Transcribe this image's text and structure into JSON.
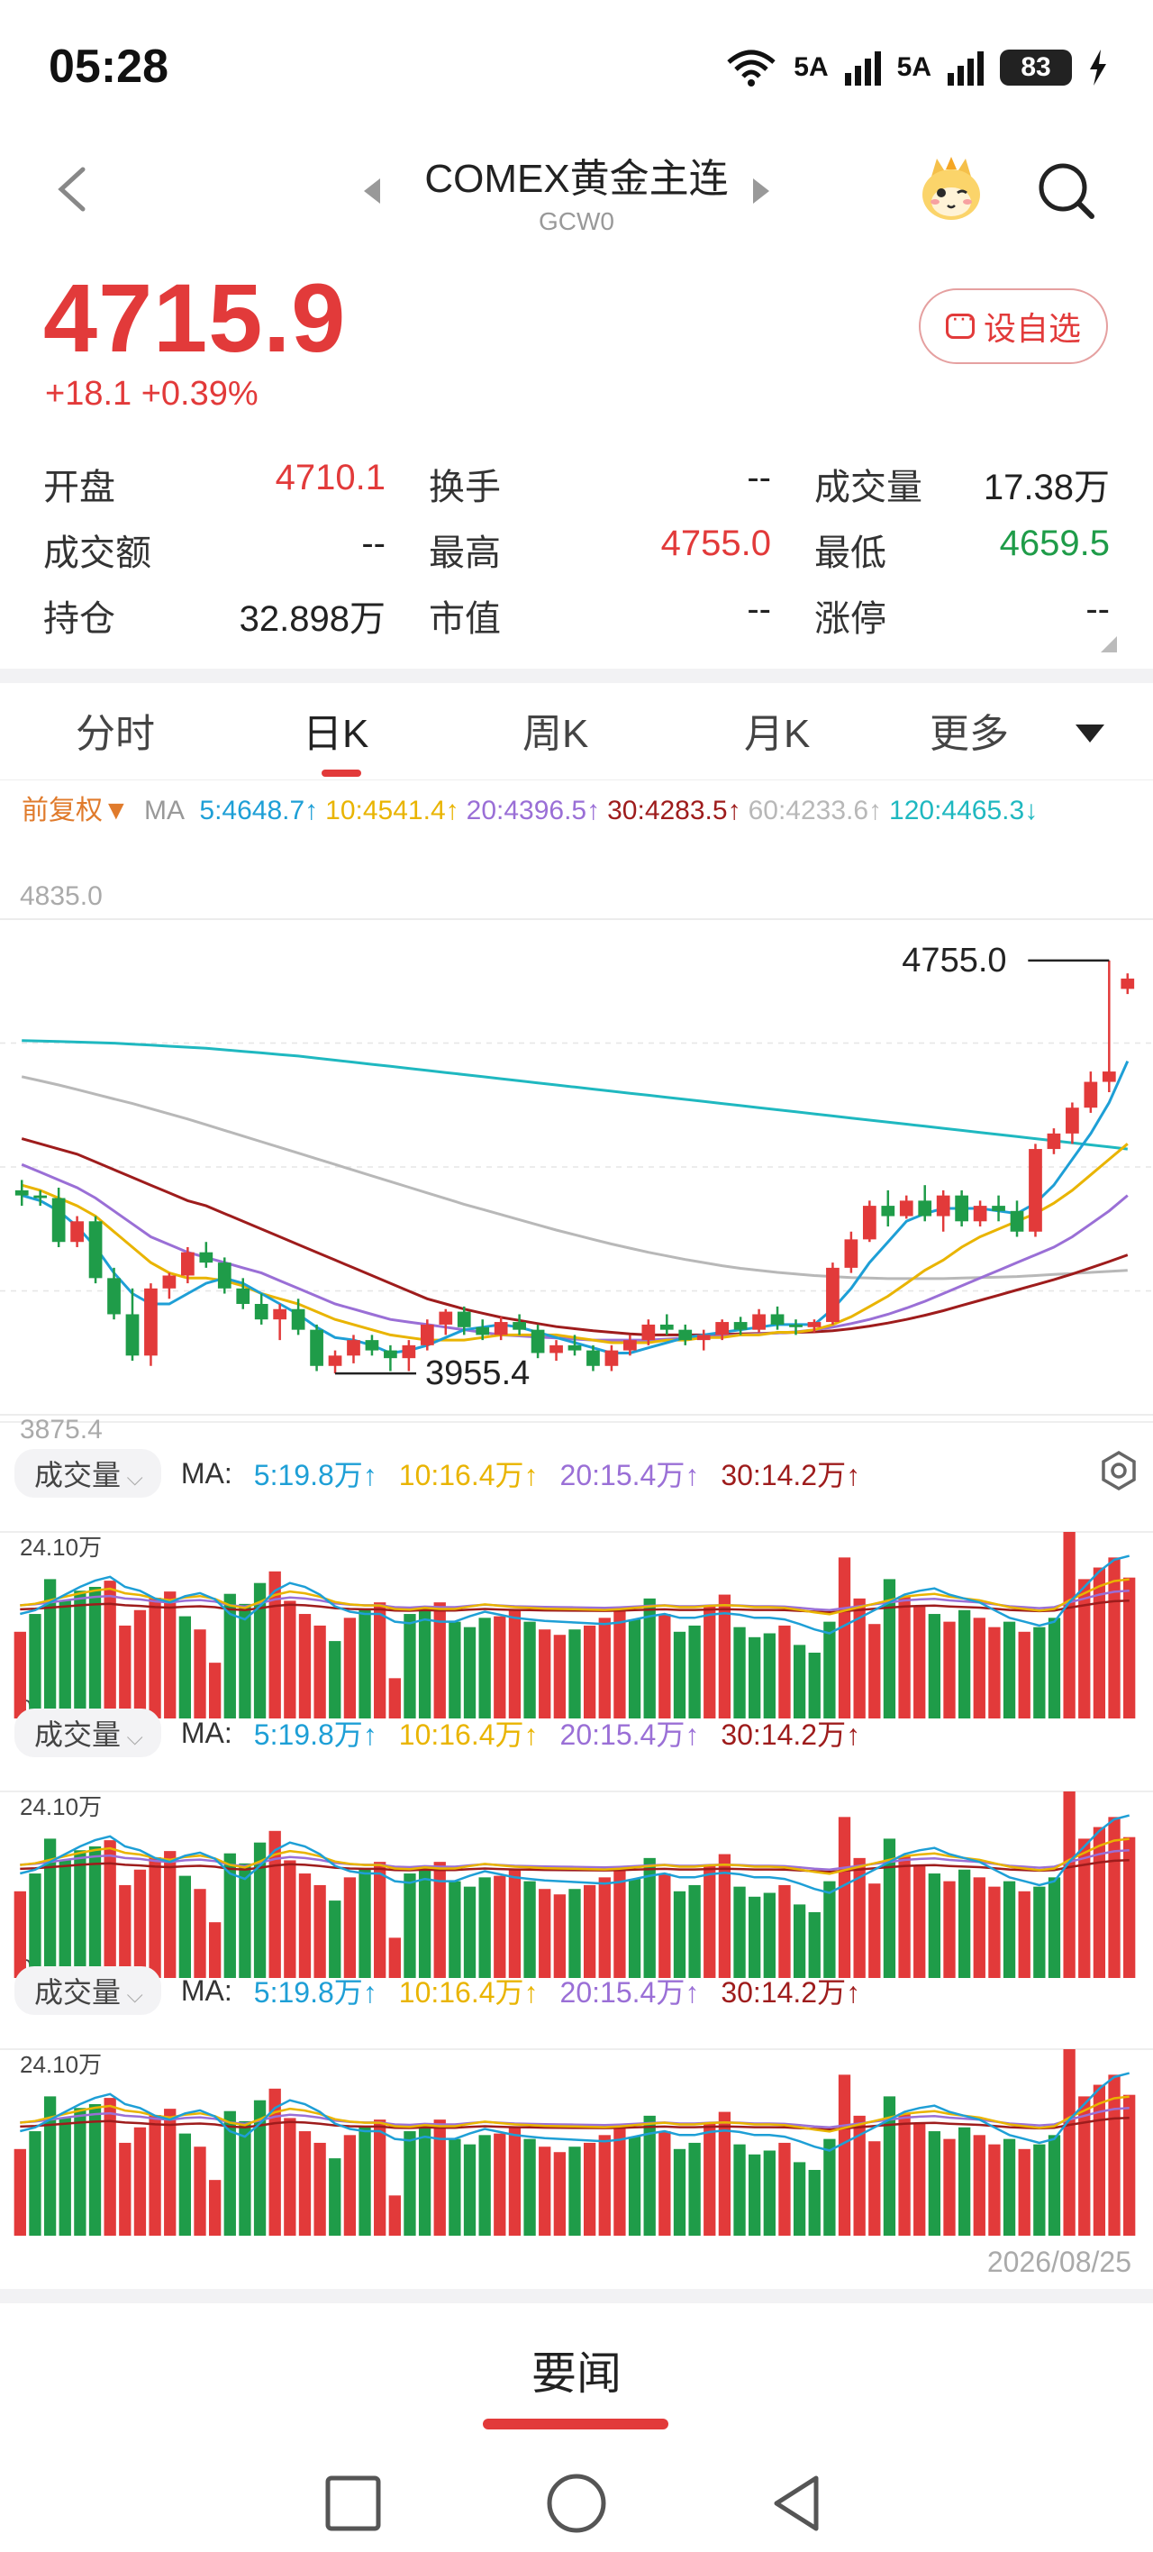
{
  "status_bar": {
    "time": "05:28",
    "network1": "5A",
    "network2": "5A",
    "battery": "83"
  },
  "header": {
    "title": "COMEX黄金主连",
    "code": "GCW0"
  },
  "quote": {
    "price": "4715.9",
    "change": "+18.1  +0.39%",
    "favorite_label": "设自选"
  },
  "stats": [
    [
      {
        "label": "开盘",
        "value": "4710.1",
        "tone": "red"
      },
      {
        "label": "换手",
        "value": "--",
        "tone": ""
      },
      {
        "label": "成交量",
        "value": "17.38万",
        "tone": ""
      }
    ],
    [
      {
        "label": "成交额",
        "value": "--",
        "tone": ""
      },
      {
        "label": "最高",
        "value": "4755.0",
        "tone": "red"
      },
      {
        "label": "最低",
        "value": "4659.5",
        "tone": "green"
      }
    ],
    [
      {
        "label": "持仓",
        "value": "32.898万",
        "tone": ""
      },
      {
        "label": "市值",
        "value": "--",
        "tone": ""
      },
      {
        "label": "涨停",
        "value": "--",
        "tone": ""
      }
    ]
  ],
  "tabs": [
    "分时",
    "日K",
    "周K",
    "月K",
    "更多"
  ],
  "active_tab": 1,
  "ma_legend": {
    "adjust": "前复权▼",
    "label": "MA",
    "items": [
      {
        "text": "5:4648.7↑",
        "color": "#1e9fd6"
      },
      {
        "text": "10:4541.4↑",
        "color": "#e9b400"
      },
      {
        "text": "20:4396.5↑",
        "color": "#9a6fd6"
      },
      {
        "text": "30:4283.5↑",
        "color": "#9e1c1c"
      },
      {
        "text": "60:4233.6↑",
        "color": "#b8b8b8"
      },
      {
        "text": "120:4465.3↓",
        "color": "#1fb8c0"
      }
    ]
  },
  "colors": {
    "up": "#e23a3a",
    "down": "#1f9c49"
  },
  "volume_panels": [
    {
      "pill": "成交量",
      "ma": "MA:",
      "items": [
        {
          "text": "5:19.8万↑",
          "color": "#1e9fd6"
        },
        {
          "text": "10:16.4万↑",
          "color": "#e9b400"
        },
        {
          "text": "20:15.4万↑",
          "color": "#9a6fd6"
        },
        {
          "text": "30:14.2万↑",
          "color": "#9e1c1c"
        }
      ],
      "max_label": "24.10万",
      "zero_label": "0"
    },
    {
      "pill": "成交量",
      "ma": "MA:",
      "items": [
        {
          "text": "5:19.8万↑",
          "color": "#1e9fd6"
        },
        {
          "text": "10:16.4万↑",
          "color": "#e9b400"
        },
        {
          "text": "20:15.4万↑",
          "color": "#9a6fd6"
        },
        {
          "text": "30:14.2万↑",
          "color": "#9e1c1c"
        }
      ],
      "max_label": "24.10万",
      "zero_label": "0"
    },
    {
      "pill": "成交量",
      "ma": "MA:",
      "items": [
        {
          "text": "5:19.8万↑",
          "color": "#1e9fd6"
        },
        {
          "text": "10:16.4万↑",
          "color": "#e9b400"
        },
        {
          "text": "20:15.4万↑",
          "color": "#9a6fd6"
        },
        {
          "text": "30:14.2万↑",
          "color": "#9e1c1c"
        }
      ],
      "max_label": "24.10万",
      "zero_label": ""
    }
  ],
  "date_label": "2026/08/25",
  "bottom_tab": "要闻",
  "chart_data": {
    "type": "candlestick",
    "y_max_label": "4835.0",
    "y_min_label": "3875.4",
    "ylim": [
      3875.4,
      4835.0
    ],
    "high_annotation": "4755.0",
    "low_annotation": "3955.4",
    "high_value": 4755.0,
    "low_value": 3955.4,
    "candles": [
      [
        4310,
        4330,
        4280,
        4300
      ],
      [
        4300,
        4310,
        4280,
        4295
      ],
      [
        4295,
        4315,
        4200,
        4210
      ],
      [
        4210,
        4260,
        4200,
        4250
      ],
      [
        4250,
        4260,
        4130,
        4140
      ],
      [
        4140,
        4160,
        4060,
        4070
      ],
      [
        4070,
        4120,
        3980,
        3990
      ],
      [
        3990,
        4130,
        3970,
        4120
      ],
      [
        4120,
        4150,
        4100,
        4145
      ],
      [
        4145,
        4200,
        4130,
        4190
      ],
      [
        4190,
        4210,
        4160,
        4170
      ],
      [
        4170,
        4180,
        4110,
        4120
      ],
      [
        4120,
        4140,
        4080,
        4090
      ],
      [
        4090,
        4110,
        4050,
        4060
      ],
      [
        4060,
        4090,
        4020,
        4080
      ],
      [
        4080,
        4100,
        4030,
        4040
      ],
      [
        4040,
        4050,
        3960,
        3970
      ],
      [
        3970,
        4000,
        3955.4,
        3990
      ],
      [
        3990,
        4030,
        3975,
        4020
      ],
      [
        4020,
        4030,
        3990,
        4000
      ],
      [
        4000,
        4010,
        3960,
        3985
      ],
      [
        3985,
        4020,
        3960,
        4010
      ],
      [
        4010,
        4060,
        4000,
        4050
      ],
      [
        4050,
        4080,
        4030,
        4075
      ],
      [
        4075,
        4085,
        4030,
        4045
      ],
      [
        4045,
        4060,
        4020,
        4030
      ],
      [
        4030,
        4065,
        4020,
        4055
      ],
      [
        4055,
        4070,
        4030,
        4040
      ],
      [
        4040,
        4050,
        3985,
        3995
      ],
      [
        3995,
        4020,
        3980,
        4010
      ],
      [
        4010,
        4030,
        3990,
        4000
      ],
      [
        4000,
        4010,
        3960,
        3970
      ],
      [
        3970,
        4010,
        3960,
        4000
      ],
      [
        4000,
        4030,
        3990,
        4020
      ],
      [
        4020,
        4060,
        4010,
        4050
      ],
      [
        4050,
        4070,
        4030,
        4040
      ],
      [
        4040,
        4050,
        4010,
        4020
      ],
      [
        4020,
        4040,
        4000,
        4030
      ],
      [
        4030,
        4060,
        4020,
        4055
      ],
      [
        4055,
        4065,
        4030,
        4040
      ],
      [
        4040,
        4080,
        4035,
        4070
      ],
      [
        4070,
        4085,
        4040,
        4050
      ],
      [
        4050,
        4060,
        4030,
        4045
      ],
      [
        4045,
        4060,
        4035,
        4055
      ],
      [
        4055,
        4170,
        4050,
        4160
      ],
      [
        4160,
        4230,
        4150,
        4215
      ],
      [
        4215,
        4290,
        4210,
        4280
      ],
      [
        4280,
        4310,
        4240,
        4260
      ],
      [
        4260,
        4300,
        4255,
        4290
      ],
      [
        4290,
        4320,
        4250,
        4260
      ],
      [
        4260,
        4310,
        4230,
        4300
      ],
      [
        4300,
        4310,
        4240,
        4250
      ],
      [
        4250,
        4290,
        4240,
        4280
      ],
      [
        4280,
        4300,
        4250,
        4270
      ],
      [
        4270,
        4290,
        4220,
        4230
      ],
      [
        4230,
        4400,
        4220,
        4390
      ],
      [
        4390,
        4430,
        4380,
        4420
      ],
      [
        4420,
        4480,
        4400,
        4470
      ],
      [
        4470,
        4540,
        4460,
        4520
      ],
      [
        4520,
        4755,
        4500,
        4540
      ],
      [
        4700,
        4730,
        4690,
        4720
      ]
    ],
    "ma5": [
      4300,
      4290,
      4270,
      4240,
      4200,
      4150,
      4110,
      4090,
      4090,
      4110,
      4130,
      4140,
      4130,
      4110,
      4090,
      4070,
      4045,
      4025,
      4020,
      4010,
      3995,
      4000,
      4010,
      4025,
      4040,
      4045,
      4050,
      4045,
      4035,
      4025,
      4015,
      4005,
      3995,
      3995,
      4005,
      4015,
      4025,
      4030,
      4035,
      4040,
      4045,
      4050,
      4050,
      4050,
      4080,
      4120,
      4170,
      4210,
      4250,
      4265,
      4275,
      4275,
      4275,
      4270,
      4265,
      4285,
      4320,
      4370,
      4420,
      4480,
      4560
    ],
    "ma10": [
      4320,
      4310,
      4295,
      4280,
      4260,
      4230,
      4200,
      4170,
      4150,
      4140,
      4140,
      4135,
      4125,
      4110,
      4100,
      4090,
      4075,
      4060,
      4050,
      4040,
      4030,
      4025,
      4020,
      4020,
      4020,
      4025,
      4030,
      4030,
      4030,
      4030,
      4025,
      4020,
      4015,
      4015,
      4015,
      4020,
      4020,
      4025,
      4025,
      4030,
      4030,
      4035,
      4035,
      4040,
      4050,
      4065,
      4085,
      4105,
      4130,
      4155,
      4175,
      4200,
      4220,
      4235,
      4250,
      4265,
      4285,
      4310,
      4340,
      4370,
      4400
    ],
    "ma20": [
      4360,
      4345,
      4330,
      4315,
      4295,
      4270,
      4245,
      4220,
      4205,
      4190,
      4180,
      4170,
      4160,
      4150,
      4135,
      4120,
      4105,
      4090,
      4080,
      4070,
      4060,
      4055,
      4050,
      4045,
      4040,
      4035,
      4030,
      4028,
      4026,
      4024,
      4022,
      4020,
      4020,
      4020,
      4020,
      4022,
      4024,
      4026,
      4028,
      4030,
      4032,
      4034,
      4036,
      4040,
      4045,
      4052,
      4060,
      4070,
      4082,
      4095,
      4110,
      4125,
      4140,
      4155,
      4170,
      4185,
      4200,
      4220,
      4245,
      4270,
      4300
    ],
    "ma30": [
      4410,
      4400,
      4390,
      4380,
      4365,
      4350,
      4335,
      4320,
      4305,
      4290,
      4280,
      4265,
      4250,
      4235,
      4220,
      4205,
      4190,
      4175,
      4160,
      4145,
      4130,
      4115,
      4100,
      4090,
      4080,
      4072,
      4064,
      4058,
      4052,
      4046,
      4042,
      4038,
      4035,
      4032,
      4030,
      4030,
      4030,
      4030,
      4031,
      4032,
      4033,
      4034,
      4035,
      4036,
      4038,
      4042,
      4047,
      4053,
      4060,
      4068,
      4077,
      4087,
      4097,
      4107,
      4117,
      4127,
      4137,
      4148,
      4160,
      4172,
      4185
    ],
    "ma60": [
      4530,
      4522,
      4514,
      4505,
      4496,
      4487,
      4478,
      4468,
      4458,
      4448,
      4437,
      4426,
      4415,
      4404,
      4393,
      4382,
      4371,
      4360,
      4349,
      4338,
      4327,
      4316,
      4305,
      4294,
      4283,
      4273,
      4263,
      4253,
      4243,
      4233,
      4224,
      4215,
      4206,
      4198,
      4190,
      4183,
      4176,
      4170,
      4164,
      4159,
      4155,
      4151,
      4148,
      4145,
      4143,
      4141,
      4140,
      4139,
      4139,
      4139,
      4139,
      4140,
      4141,
      4142,
      4143,
      4145,
      4147,
      4149,
      4151,
      4153,
      4155
    ],
    "ma120": [
      4600,
      4599,
      4598,
      4597,
      4596,
      4595,
      4593,
      4591,
      4589,
      4587,
      4585,
      4582,
      4579,
      4576,
      4573,
      4570,
      4566,
      4562,
      4558,
      4554,
      4550,
      4546,
      4542,
      4538,
      4534,
      4530,
      4526,
      4522,
      4518,
      4514,
      4510,
      4506,
      4502,
      4498,
      4494,
      4490,
      4486,
      4482,
      4478,
      4474,
      4470,
      4466,
      4462,
      4458,
      4454,
      4450,
      4446,
      4442,
      4438,
      4434,
      4430,
      4426,
      4422,
      4418,
      4414,
      4410,
      4406,
      4402,
      4398,
      4394,
      4390
    ],
    "volume_max": 24.1,
    "volumes": [
      11.2,
      13.5,
      18.0,
      15.2,
      16.5,
      17.0,
      17.8,
      12.0,
      14.0,
      15.6,
      16.4,
      13.2,
      11.5,
      7.2,
      16.1,
      14.8,
      17.5,
      19.0,
      15.2,
      13.5,
      12.0,
      10.0,
      13.0,
      14.0,
      15.0,
      5.2,
      13.5,
      14.5,
      15.0,
      12.5,
      11.8,
      13.0,
      13.2,
      14.0,
      12.5,
      11.5,
      10.8,
      11.5,
      12.0,
      13.0,
      14.0,
      12.8,
      15.5,
      13.5,
      11.2,
      12.0,
      14.5,
      16.0,
      11.8,
      10.5,
      11.0,
      12.0,
      9.5,
      8.5,
      12.5,
      20.8,
      15.5,
      12.2,
      18.0,
      15.8,
      14.5,
      13.5,
      12.5,
      14.0,
      13.0,
      11.8,
      12.5,
      11.2,
      11.8,
      13.0,
      24.1,
      18.0,
      19.5,
      20.8,
      18.2
    ],
    "volume_up": [
      true,
      false,
      false,
      false,
      false,
      false,
      true,
      true,
      true,
      true,
      true,
      false,
      true,
      true,
      false,
      false,
      false,
      true,
      true,
      true,
      true,
      false,
      true,
      false,
      true,
      true,
      false,
      false,
      true,
      false,
      false,
      false,
      true,
      true,
      false,
      true,
      true,
      false,
      true,
      true,
      true,
      false,
      false,
      true,
      false,
      false,
      true,
      true,
      false,
      false,
      false,
      true,
      false,
      false,
      false,
      true,
      true,
      true,
      false,
      true,
      true,
      false,
      true,
      false,
      true,
      true,
      false,
      true,
      false,
      false,
      true,
      true,
      true,
      true,
      true
    ],
    "vol_ma5": [
      13.5,
      14,
      15,
      16,
      17,
      17.8,
      18.3,
      17,
      16.5,
      15.5,
      15,
      15.8,
      16.2,
      15.4,
      13.5,
      12.8,
      14.5,
      16.5,
      17.5,
      17,
      16,
      14.5,
      13.8,
      13.5,
      13.5,
      12.5,
      12.3,
      12.8,
      12.5,
      12.5,
      13.2,
      13.8,
      13.4,
      13,
      12.8,
      12.6,
      12.5,
      12.4,
      12.3,
      12.2,
      12.4,
      12.8,
      13.2,
      13.5,
      13,
      13,
      13.4,
      13.6,
      13.4,
      13,
      13,
      12.8,
      12.2,
      11.5,
      11,
      12,
      13,
      14,
      15,
      16,
      16.5,
      16.8,
      16,
      15.5,
      15,
      14,
      13,
      12.5,
      12,
      12.5,
      15,
      17,
      19,
      20.5,
      21
    ]
  }
}
